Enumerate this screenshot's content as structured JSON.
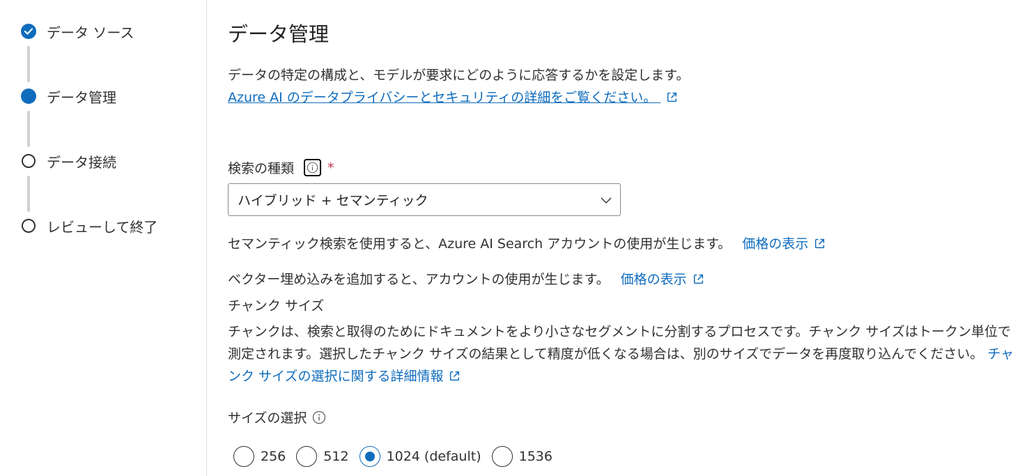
{
  "stepper": {
    "steps": [
      {
        "label": "データ ソース",
        "state": "completed"
      },
      {
        "label": "データ管理",
        "state": "current"
      },
      {
        "label": "データ接続",
        "state": "pending"
      },
      {
        "label": "レビューして終了",
        "state": "pending"
      }
    ]
  },
  "main": {
    "title": "データ管理",
    "description": "データの特定の構成と、モデルが要求にどのように応答するかを設定します。",
    "privacy_link": "Azure AI のデータプライバシーとセキュリティの詳細をご覧ください。",
    "search_type": {
      "label": "検索の種類",
      "required_mark": "*",
      "value": "ハイブリッド + セマンティック"
    },
    "semantic_note": "セマンティック検索を使用すると、Azure AI Search アカウントの使用が生じます。",
    "vector_note": "ベクター埋め込みを追加すると、アカウントの使用が生じます。",
    "pricing_link": "価格の表示",
    "chunk": {
      "heading": "チャンク サイズ",
      "description": "チャンクは、検索と取得のためにドキュメントをより小さなセグメントに分割するプロセスです。チャンク サイズはトークン単位で測定されます。選択したチャンク サイズの結果として精度が低くなる場合は、別のサイズでデータを再度取り込んでください。",
      "learn_more_link": "チャンク サイズの選択に関する詳細情報",
      "size_label": "サイズの選択",
      "options": [
        {
          "label": "256",
          "checked": false
        },
        {
          "label": "512",
          "checked": false
        },
        {
          "label": "1024 (default)",
          "checked": true
        },
        {
          "label": "1536",
          "checked": false
        }
      ]
    }
  },
  "colors": {
    "accent": "#0f6cbd",
    "text": "#323130",
    "required": "#c4314b",
    "connector": "#d2d0ce"
  },
  "icons": [
    "checkmark-icon",
    "open-external-icon",
    "info-icon",
    "chevron-down-icon"
  ]
}
